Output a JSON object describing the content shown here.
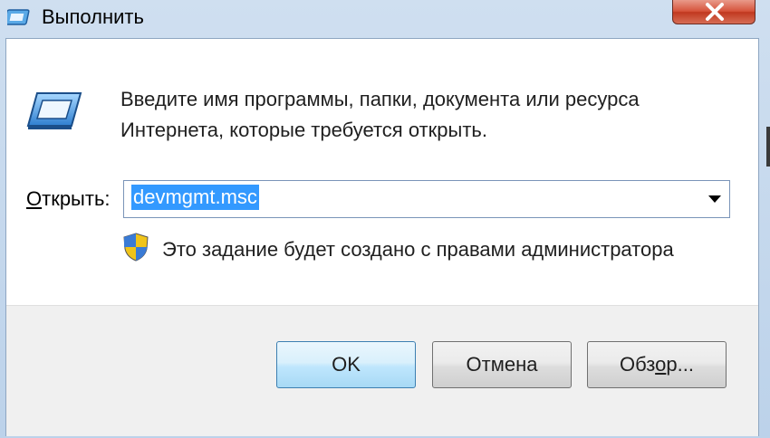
{
  "window": {
    "title": "Выполнить",
    "title_icon": "run-icon",
    "close_icon": "close-icon"
  },
  "main": {
    "description_line1": "Введите имя программы, папки, документа или ресурса",
    "description_line2": "Интернета, которые требуется открыть.",
    "open_label_accel": "О",
    "open_label_rest": "ткрыть:",
    "open_value": "devmgmt.msc",
    "admin_note": "Это задание будет создано с правами администратора",
    "shield_icon": "uac-shield-icon"
  },
  "buttons": {
    "ok": "OK",
    "cancel": "Отмена",
    "browse_pre": "Обз",
    "browse_accel": "о",
    "browse_post": "р..."
  },
  "colors": {
    "selection": "#3399ff",
    "close_button": "#c0381f",
    "default_button_border": "#3c7fb1"
  }
}
